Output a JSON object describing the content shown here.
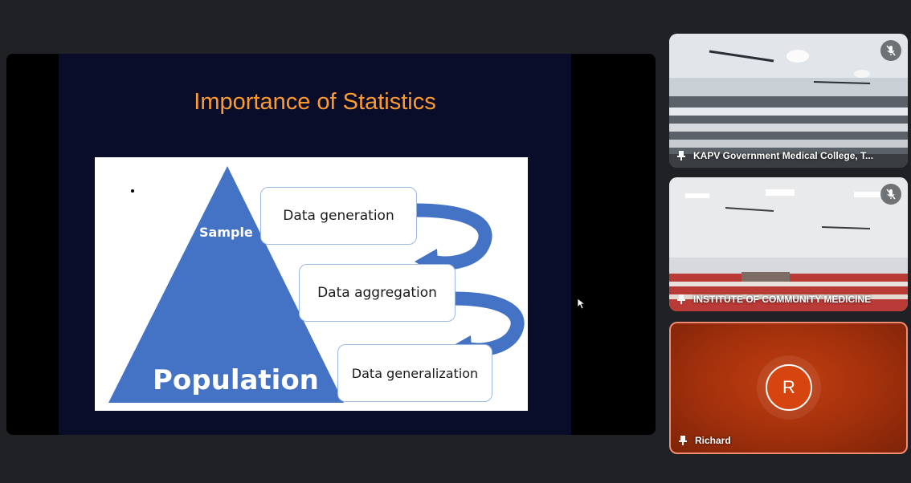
{
  "presentation": {
    "title": "Importance of Statistics",
    "triangle": {
      "top_label": "Sample",
      "bottom_label": "Population"
    },
    "steps": [
      "Data generation",
      "Data aggregation",
      "Data generalization"
    ],
    "colors": {
      "title": "#ff9a2e",
      "triangle": "#4472c4",
      "slide_bg": "#0a0d2a"
    }
  },
  "participants": [
    {
      "name": "KAPV Government Medical College, T...",
      "muted": true,
      "icon": "mic-off-icon"
    },
    {
      "name": "INSTITUTE OF COMMUNITY MEDICINE",
      "muted": true,
      "icon": "mic-off-icon"
    },
    {
      "name": "Richard",
      "avatar_initial": "R",
      "muted": false,
      "color": "#d6450f"
    }
  ]
}
